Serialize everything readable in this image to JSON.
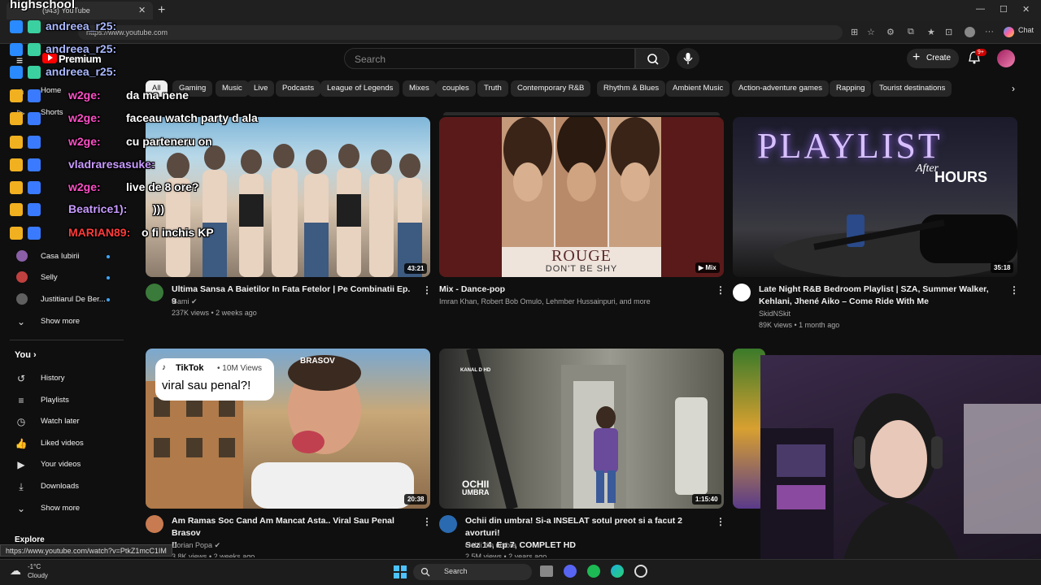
{
  "browser": {
    "tab_title": "(943) YouTube",
    "url": "https://www.youtube.com",
    "copilot_label": "Chat"
  },
  "header": {
    "logo_text": "Premium",
    "search_placeholder": "Search",
    "create_label": "Create",
    "notifications_badge": "9+"
  },
  "chips": [
    "All",
    "Gaming",
    "Music",
    "Live",
    "Podcasts",
    "League of Legends",
    "Mixes",
    "couples",
    "Truth",
    "Contemporary R&B",
    "Rhythm & Blues",
    "Ambient Music",
    "Action-adventure games",
    "Rapping",
    "Tourist destinations"
  ],
  "sidebar": {
    "top_items": [
      "Home",
      "Shorts"
    ],
    "subscriptions": [
      {
        "name": "Casa Iubirii",
        "color": "#8a5fa8"
      },
      {
        "name": "Selly",
        "color": "#c04040"
      },
      {
        "name": "Justitiarul De Ber...",
        "color": "#606060"
      }
    ],
    "show_more_1": "Show more",
    "you_title": "You",
    "you_items": [
      {
        "label": "History",
        "icon": "history-icon",
        "glyph": "↺"
      },
      {
        "label": "Playlists",
        "icon": "playlists-icon",
        "glyph": "≡"
      },
      {
        "label": "Watch later",
        "icon": "watch-later-icon",
        "glyph": "◷"
      },
      {
        "label": "Liked videos",
        "icon": "thumbs-up-icon",
        "glyph": "👍"
      },
      {
        "label": "Your videos",
        "icon": "your-videos-icon",
        "glyph": "▶"
      },
      {
        "label": "Downloads",
        "icon": "download-icon",
        "glyph": "⤓"
      }
    ],
    "show_more_2": "Show more",
    "explore_title": "Explore"
  },
  "videos": [
    {
      "title": "Ultima Sansa A Baietilor In Fata Fetelor | Pe Combinatii Ep. 9",
      "channel": "Gami",
      "meta": "237K views • 2 weeks ago",
      "duration": "43:21"
    },
    {
      "title": "Mix - Dance-pop",
      "channel": "Imran Khan, Robert Bob Omulo, Lehmber Hussainpuri, and more",
      "meta": "",
      "duration": "Mix",
      "thumb_text_1": "ROUGE",
      "thumb_text_2": "DON'T BE SHY"
    },
    {
      "title_line1": "Late Night R&B Bedroom Playlist | SZA, Summer Walker,",
      "title_line2": "Kehlani, Jhené Aiko – Come Ride With Me",
      "channel": "SkidNSkit",
      "meta": "89K views • 1 month ago",
      "duration": "35:18",
      "thumb_text_1": "PLAYLIST",
      "thumb_text_2": "After",
      "thumb_text_3": "HOURS"
    },
    {
      "title_line1": "Am Ramas Soc Cand Am Mancat Asta.. Viral Sau Penal Brasov",
      "title_line2": "!!",
      "channel": "Dorian Popa",
      "meta": "3.8K views • 2 weeks ago",
      "duration": "20:38",
      "tiktok_label": "TikTok",
      "tiktok_views": "• 10M Views",
      "tiktok_caption": "viral sau penal?!",
      "sign": "BRASOV"
    },
    {
      "title_line1": "Ochii din umbra! Si-a INSELAT sotul preot si a facut 2 avorturi!",
      "title_line2": "Sez 14, Ep 7, COMPLET HD",
      "channel": "Ochii din umbra",
      "meta": "2.5M views • 2 years ago",
      "duration": "1:15:40",
      "logo": "KANAL D HD",
      "brand_1": "OCHII",
      "brand_2": "UMBRA"
    }
  ],
  "chat": {
    "stream_title": "highschool",
    "messages": [
      {
        "user": "andreea_r25:",
        "text": "",
        "color": "#aab8ff"
      },
      {
        "user": "andreea_r25:",
        "text": "",
        "color": "#aab8ff"
      },
      {
        "user": "andreea_r25:",
        "text": "",
        "color": "#aab8ff"
      },
      {
        "user": "w2ge:",
        "text": "da ma nene",
        "color": "#ff4fc8"
      },
      {
        "user": "w2ge:",
        "text": "faceau watch party d ala",
        "color": "#ff4fc8"
      },
      {
        "user": "w2ge:",
        "text": "cu parteneru on",
        "color": "#ff4fc8"
      },
      {
        "user": "vladraresasuke:",
        "text": "",
        "color": "#c89bff"
      },
      {
        "user": "w2ge:",
        "text": "live de 8 ore?",
        "color": "#ff4fc8"
      },
      {
        "user": "Beatrice1):",
        "text": ")))",
        "color": "#c89bff"
      },
      {
        "user": "MARIAN89:",
        "text": "o fi inchis KP",
        "color": "#ff3b3b"
      }
    ]
  },
  "status_url": "https://www.youtube.com/watch?v=PtkZ1mcC1IM",
  "taskbar": {
    "temperature": "-1°C",
    "weather": "Cloudy",
    "search_label": "Search"
  }
}
